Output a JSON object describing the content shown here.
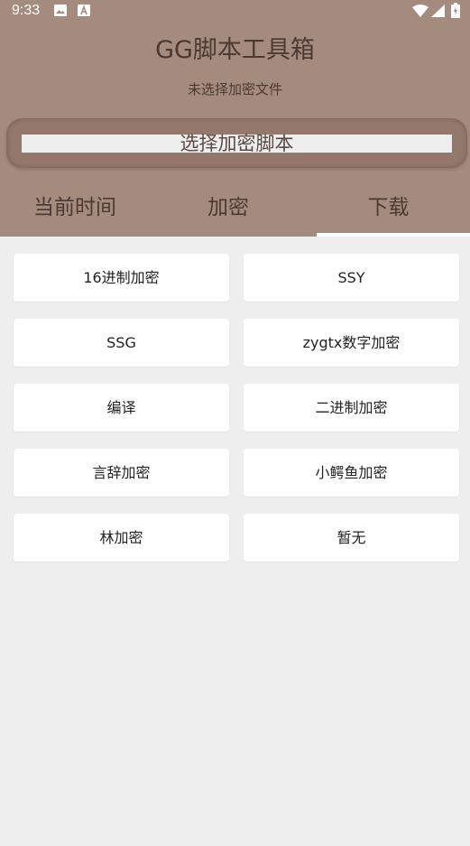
{
  "status_bar": {
    "time": "9:33",
    "icons": [
      "image-icon",
      "a-icon",
      "wifi-icon",
      "signal-icon",
      "battery-icon"
    ]
  },
  "header": {
    "title": "GG脚本工具箱",
    "file_status": "未选择加密文件",
    "select_button_label": "选择加密脚本",
    "background_color": "#a48b7e"
  },
  "tabs": [
    {
      "label": "当前时间"
    },
    {
      "label": "加密"
    },
    {
      "label": "下载",
      "selected": true
    }
  ],
  "items": [
    {
      "label": "16进制加密"
    },
    {
      "label": "SSY"
    },
    {
      "label": "SSG"
    },
    {
      "label": "zygtx数字加密"
    },
    {
      "label": "编译"
    },
    {
      "label": "二进制加密"
    },
    {
      "label": "言辞加密"
    },
    {
      "label": "小鳄鱼加密"
    },
    {
      "label": "林加密"
    },
    {
      "label": "暂无"
    }
  ]
}
